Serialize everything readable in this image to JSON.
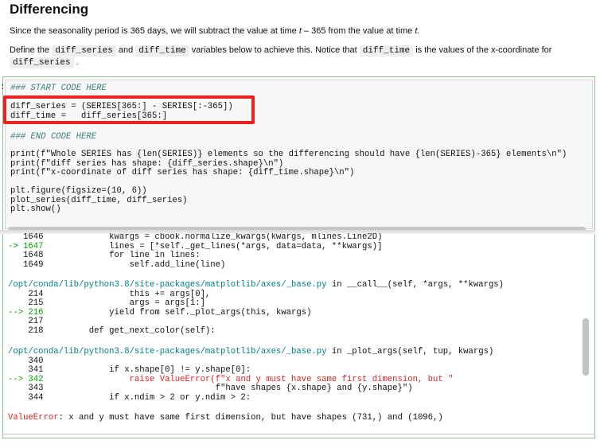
{
  "markdown": {
    "heading": "Differencing",
    "p1_a": "Since the seasonality period is 365 days, we will subtract the value at time ",
    "p1_t": "t",
    "p1_b": " – 365 from the value at time ",
    "p1_t2": "t",
    "p1_c": ".",
    "p2_a": "Define the ",
    "p2_c1": "diff_series",
    "p2_b": " and ",
    "p2_c2": "diff_time",
    "p2_c": " variables below to achieve this. Notice that ",
    "p2_c3": "diff_time",
    "p2_d": " is the values of the x-coordinate for",
    "p2_c4": "diff_series",
    "p2_e": " ."
  },
  "prompt_marker": ":",
  "code_cell": {
    "start_comment": "### START CODE HERE",
    "line1": "diff_series = (SERIES[365:] - SERIES[:-365])",
    "line2": "diff_time =   diff_series[365:]",
    "end_comment": "### END CODE HERE",
    "print1": "print(f\"Whole SERIES has {len(SERIES)} elements so the differencing should have {len(SERIES)-365} elements\\n\")",
    "print2": "print(f\"diff series has shape: {diff_series.shape}\\n\")",
    "print3": "print(f\"x-coordinate of diff series has shape: {diff_time.shape}\\n\")",
    "fig1": "plt.figure(figsize=(10, 6))",
    "fig2": "plot_series(diff_time, diff_series)",
    "fig3": "plt.show()"
  },
  "traceback": {
    "l1646": "   1646             kwargs = cbook.normalize_kwargs(kwargs, mlines.Line2D)",
    "l1647_arrow": "-> 1647",
    "l1647": "             lines = [*self._get_lines(*args, data=data, **kwargs)]",
    "l1648": "   1648             for line in lines:",
    "l1649": "   1649                 self.add_line(line)",
    "path1": "/opt/conda/lib/python3.8/site-packages/matplotlib/axes/_base.py",
    "path1_tail": " in __call__(self, *args, **kwargs)",
    "l214": "    214                 this += args[0],",
    "l215": "    215                 args = args[1:]",
    "l216_arrow": "--> 216",
    "l216": "             yield from self._plot_args(this, kwargs)",
    "l217": "    217",
    "l218": "    218         def get_next_color(self):",
    "path2": "/opt/conda/lib/python3.8/site-packages/matplotlib/axes/_base.py",
    "path2_tail": " in _plot_args(self, tup, kwargs)",
    "l340": "    340",
    "l341": "    341             if x.shape[0] != y.shape[0]:",
    "l342_arrow": "--> 342",
    "l342": "                 raise ValueError(f\"x and y must have same first dimension, but \"",
    "l343": "    343                                  f\"have shapes {x.shape} and {y.shape}\")",
    "l344": "    344             if x.ndim > 2 or y.ndim > 2:",
    "error_name": "ValueError",
    "error_msg": ": x and y must have same first dimension, but have shapes (731,) and (1096,)"
  },
  "colors": {
    "highlight_box": "#e8231f",
    "cell_border": "#8fc18f",
    "error_red": "#d62525"
  }
}
